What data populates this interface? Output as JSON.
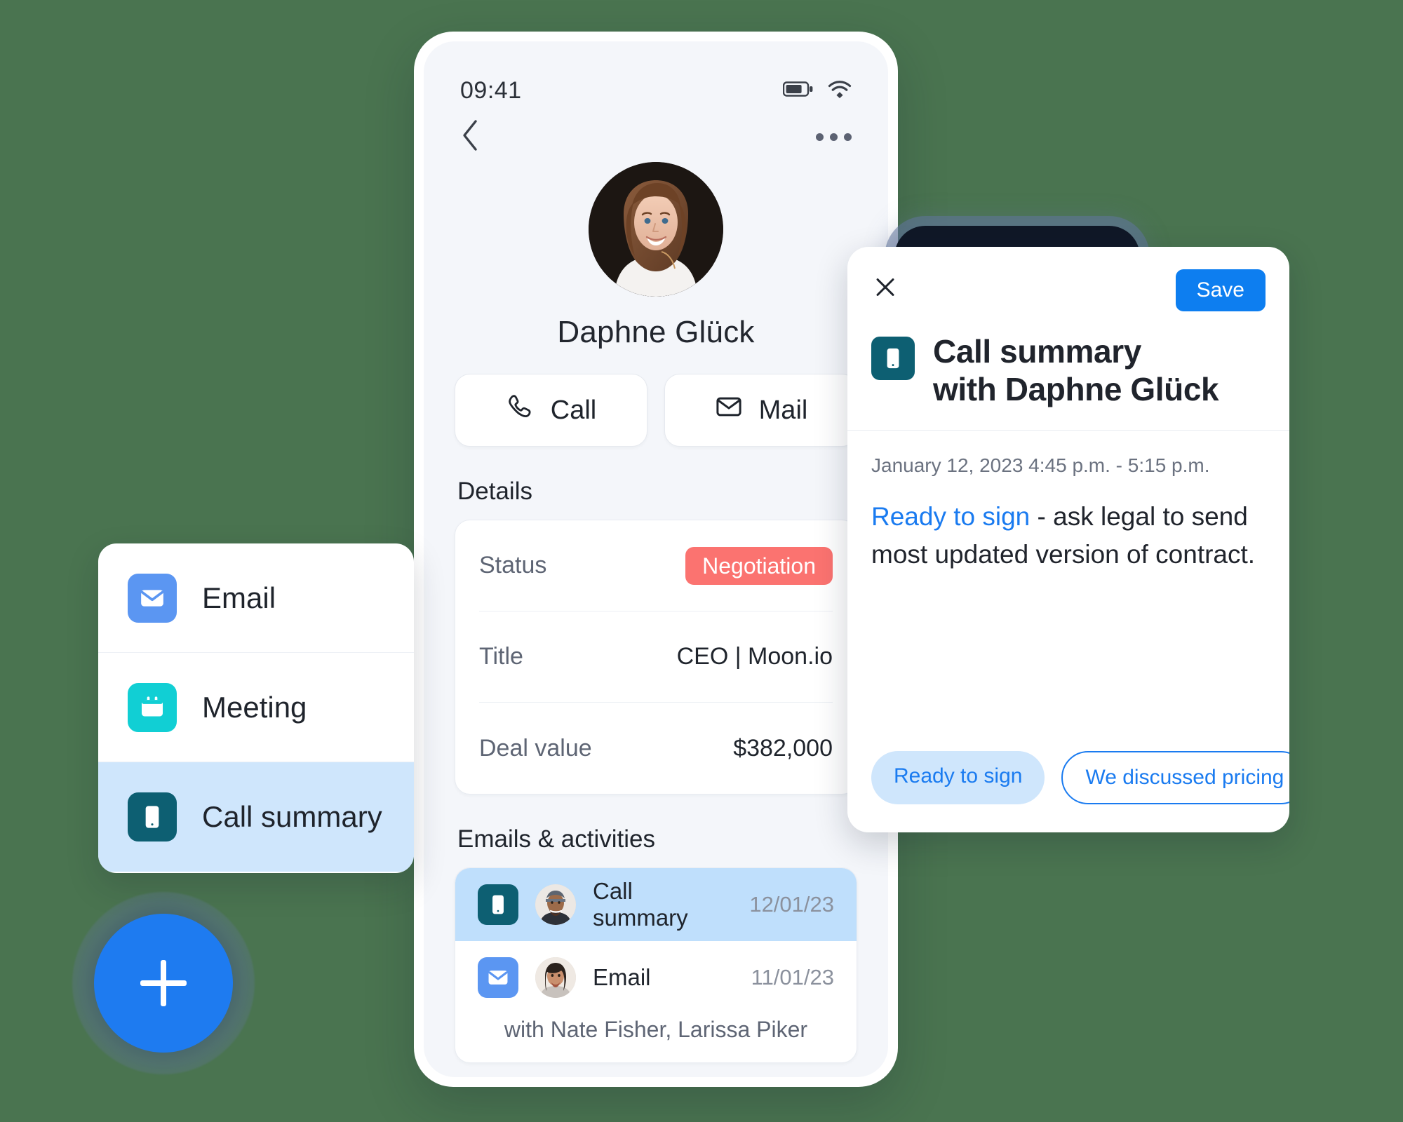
{
  "theme": {
    "background": "#4a7450",
    "accent_blue": "#1e7bf0",
    "teal": "#0d5f72",
    "cyan": "#11cfd4",
    "mail_blue": "#5b96f2",
    "badge_red": "#fb7370",
    "selected_blue": "#cfe6fc"
  },
  "phone": {
    "statusbar": {
      "time": "09:41",
      "battery_icon": "battery-icon",
      "wifi_icon": "wifi-icon"
    },
    "navbar": {
      "back_icon": "chevron-left-icon",
      "more_icon": "more-horizontal-icon"
    },
    "contact": {
      "avatar": "contact-avatar",
      "name": "Daphne Glück"
    },
    "actions": [
      {
        "label": "Call",
        "icon": "phone-icon"
      },
      {
        "label": "Mail",
        "icon": "envelope-icon"
      }
    ],
    "details": {
      "title": "Details",
      "rows": [
        {
          "label": "Status",
          "value": "Negotiation",
          "type": "badge"
        },
        {
          "label": "Title",
          "value": "CEO | Moon.io",
          "type": "text"
        },
        {
          "label": "Deal value",
          "value": "$382,000",
          "type": "text"
        }
      ]
    },
    "activities": {
      "title": "Emails & activities",
      "items": [
        {
          "icon": "mobile-icon",
          "icon_color": "#0d5f72",
          "avatar": "avatar-male",
          "label": "Call summary",
          "date": "12/01/23",
          "selected": true
        },
        {
          "icon": "envelope-icon",
          "icon_color": "#5b96f2",
          "avatar": "avatar-female",
          "label": "Email",
          "date": "11/01/23",
          "selected": false
        }
      ],
      "footer_note": "with Nate Fisher, Larissa Piker"
    }
  },
  "menu_panel": {
    "items": [
      {
        "label": "Email",
        "icon": "envelope-icon",
        "icon_color": "#5b96f2",
        "selected": false
      },
      {
        "label": "Meeting",
        "icon": "calendar-icon",
        "icon_color": "#11cfd4",
        "selected": false
      },
      {
        "label": "Call summary",
        "icon": "mobile-icon",
        "icon_color": "#0d5f72",
        "selected": true
      }
    ]
  },
  "fab": {
    "icon": "plus-icon",
    "label": "Add"
  },
  "summary_card": {
    "close_icon": "close-icon",
    "save_label": "Save",
    "header_icon": "mobile-icon",
    "title_line1": "Call summary",
    "title_line2": "with Daphne Glück",
    "meta": "January 12, 2023  4:45 p.m. - 5:15 p.m.",
    "body_highlight": "Ready to sign",
    "body_rest": " - ask legal to send most updated version of contract.",
    "chips": [
      {
        "label": "Ready to sign",
        "style": "filled"
      },
      {
        "label": "We discussed pricing",
        "style": "outline"
      }
    ]
  }
}
